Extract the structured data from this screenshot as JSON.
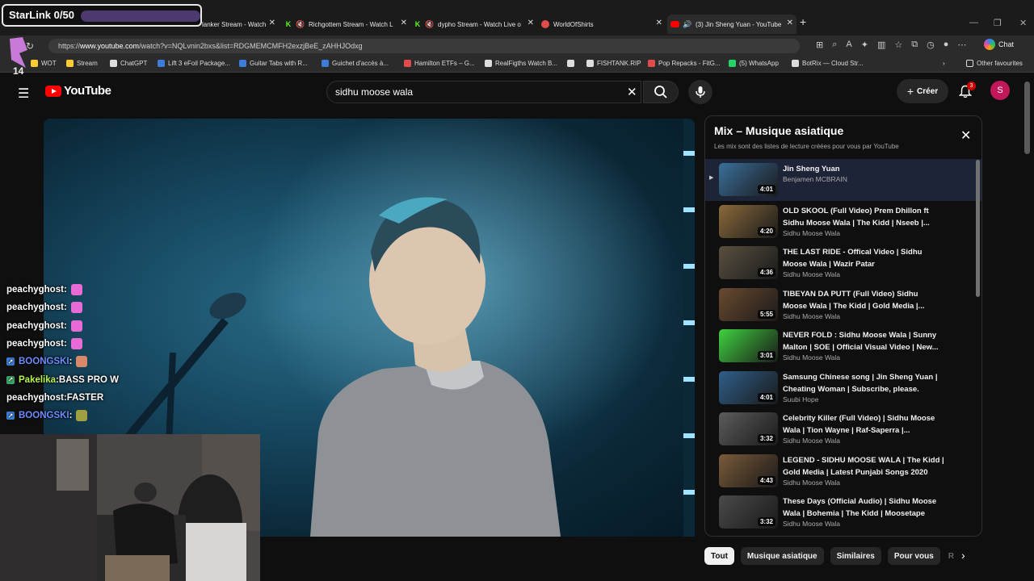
{
  "overlay": {
    "starlink_label": "StarLink 0/50",
    "chat": [
      {
        "user": "peachyghost",
        "sep": " :",
        "msg": "",
        "emote": "pink",
        "user_color": "#ffffff"
      },
      {
        "user": "peachyghost",
        "sep": " :",
        "msg": "",
        "emote": "pink",
        "user_color": "#ffffff"
      },
      {
        "user": "peachyghost",
        "sep": " :",
        "msg": "",
        "emote": "pink",
        "user_color": "#ffffff"
      },
      {
        "user": "peachyghost",
        "sep": " :",
        "msg": "",
        "emote": "pink",
        "user_color": "#ffffff"
      },
      {
        "user": "BOONGSKI",
        "sep": " :",
        "msg": "",
        "emote": "face",
        "user_color": "#6c8cff"
      },
      {
        "user": "Pakelika",
        "sep": " :",
        "msg": " BASS PRO W",
        "emote": "",
        "user_color": "#b6f24a"
      },
      {
        "user": "peachyghost",
        "sep": " :",
        "msg": " FASTER",
        "emote": "",
        "user_color": "#ffffff"
      },
      {
        "user": "BOONGSKI",
        "sep": " :",
        "msg": "",
        "emote": "hat",
        "user_color": "#6c8cff"
      }
    ]
  },
  "browser": {
    "tabs": [
      {
        "label": "lanker Stream - Watch",
        "icon": "kick-icon"
      },
      {
        "label": "Richgottem Stream - Watch L",
        "icon": "kick-icon"
      },
      {
        "label": "dypho Stream - Watch Live o",
        "icon": "kick-icon"
      },
      {
        "label": "WorldOfShirts",
        "icon": "globe-icon"
      },
      {
        "label": "(3) Jin Sheng Yuan - YouTube",
        "icon": "youtube-icon"
      }
    ],
    "url_prefix": "https://",
    "url_domain": "www.youtube.com",
    "url_path": "/watch?v=NQLvnin2bxs&list=RDGMEMCMFH2exzjBeE_zAHHJOdxg",
    "chat_label": "Chat",
    "bookmarks": [
      {
        "label": "WOT",
        "color": "#ffcc33"
      },
      {
        "label": "Stream",
        "color": "#ffcc33"
      },
      {
        "label": "ChatGPT",
        "color": "#dddddd"
      },
      {
        "label": "Lift 3 eFoil Package...",
        "color": "#3b7dd8"
      },
      {
        "label": "Guitar Tabs with R...",
        "color": "#3b7dd8"
      },
      {
        "label": "Guichet d'accès à...",
        "color": "#3b7dd8"
      },
      {
        "label": "Hamilton ETFs – G...",
        "color": "#e04c4c"
      },
      {
        "label": "RealFigths Watch B...",
        "color": "#dddddd"
      },
      {
        "label": "",
        "color": "#dddddd"
      },
      {
        "label": "FISHTANK.RIP",
        "color": "#dddddd"
      },
      {
        "label": "Pop Repacks - FitG...",
        "color": "#e04c4c"
      },
      {
        "label": "(5) WhatsApp",
        "color": "#25d366"
      },
      {
        "label": "BotRix — Cloud Str...",
        "color": "#dddddd"
      }
    ],
    "other_favourites": "Other favourites"
  },
  "youtube": {
    "logo_text": "YouTube",
    "search_value": "sidhu moose wala",
    "create_label": "Créer",
    "notification_count": "3",
    "avatar_letter": "S",
    "playlist": {
      "title": "Mix – Musique asiatique",
      "subtitle": "Les mix sont des listes de lecture créées pour vous par YouTube",
      "items": [
        {
          "title": "Jin Sheng Yuan",
          "channel": "Benjamen MCBRAIN",
          "duration": "4:01",
          "thumb": "#3a6f9a",
          "active": true
        },
        {
          "title": "OLD SKOOL (Full Video) Prem Dhillon ft Sidhu Moose Wala | The Kidd | Nseeb |...",
          "channel": "Sidhu Moose Wala",
          "duration": "4:20",
          "thumb": "#8a6a3a",
          "active": false
        },
        {
          "title": "THE LAST RIDE - Offical Video | Sidhu Moose Wala | Wazir Patar",
          "channel": "Sidhu Moose Wala",
          "duration": "4:36",
          "thumb": "#5a5040",
          "active": false
        },
        {
          "title": "TIBEYAN DA PUTT (Full Video) Sidhu Moose Wala | The Kidd | Gold Media |...",
          "channel": "Sidhu Moose Wala",
          "duration": "5:55",
          "thumb": "#6a4a30",
          "active": false
        },
        {
          "title": "NEVER FOLD : Sidhu Moose Wala | Sunny Malton | SOE | Official Visual Video | New...",
          "channel": "Sidhu Moose Wala",
          "duration": "3:01",
          "thumb": "#3fd13f",
          "active": false
        },
        {
          "title": "Samsung Chinese song | Jin Sheng Yuan | Cheating Woman | Subscribe, please.",
          "channel": "Suubi Hope",
          "duration": "4:01",
          "thumb": "#2f5f8a",
          "active": false
        },
        {
          "title": "Celebrity Killer (Full Video) | Sidhu Moose Wala | Tion Wayne | Raf-Saperra |...",
          "channel": "Sidhu Moose Wala",
          "duration": "3:32",
          "thumb": "#5c5c5c",
          "active": false
        },
        {
          "title": "LEGEND - SIDHU MOOSE WALA | The Kidd | Gold Media | Latest Punjabi Songs 2020",
          "channel": "Sidhu Moose Wala",
          "duration": "4:43",
          "thumb": "#7a5a3a",
          "active": false
        },
        {
          "title": "These Days (Official Audio) | Sidhu Moose Wala | Bohemia | The Kidd | Moosetape",
          "channel": "Sidhu Moose Wala",
          "duration": "3:32",
          "thumb": "#4a4a4a",
          "active": false
        }
      ]
    },
    "chips": [
      "Tout",
      "Musique asiatique",
      "Similaires",
      "Pour vous",
      "R"
    ]
  }
}
